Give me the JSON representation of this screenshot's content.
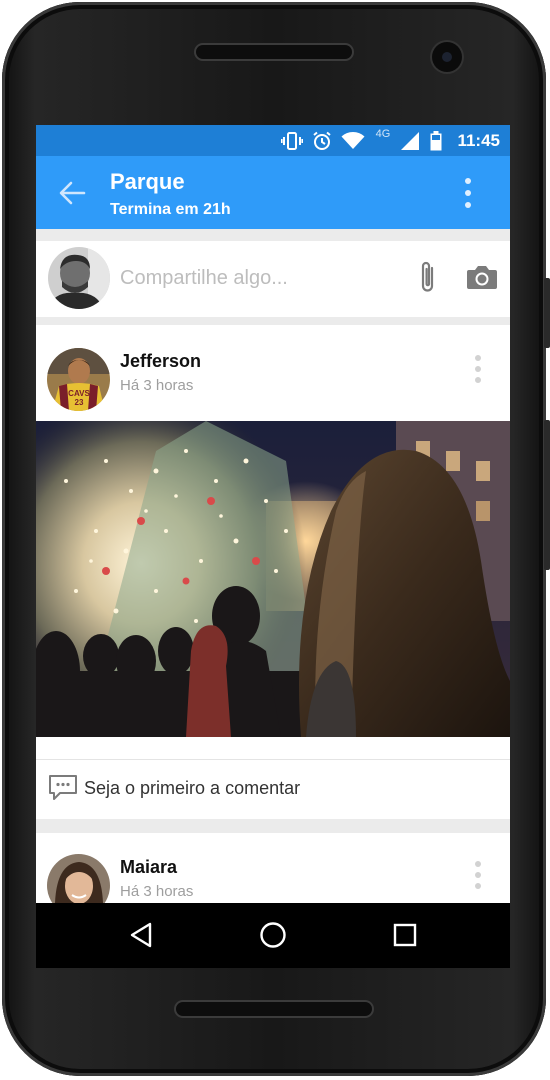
{
  "status_bar": {
    "network": "4G",
    "time": "11:45",
    "icons": [
      "vibrate-icon",
      "alarm-icon",
      "wifi-icon",
      "signal-icon",
      "battery-icon"
    ]
  },
  "app_bar": {
    "title": "Parque",
    "subtitle": "Termina em 21h",
    "icons": [
      "back-arrow-icon",
      "more-vert-icon"
    ]
  },
  "composer": {
    "placeholder": "Compartilhe algo...",
    "icons": [
      "attach-icon",
      "camera-icon"
    ]
  },
  "posts": [
    {
      "author": "Jefferson",
      "time": "Há 3 horas",
      "comment_prompt": "Seja o primeiro a comentar"
    },
    {
      "author": "Maiara",
      "time": "Há 3 horas"
    }
  ],
  "nav_bar": {
    "icons": [
      "back-triangle-icon",
      "home-circle-icon",
      "recents-square-icon"
    ]
  },
  "colors": {
    "app_bar": "#2f9bf9",
    "status_bar": "#1e7fd6",
    "background": "#ebebeb"
  }
}
